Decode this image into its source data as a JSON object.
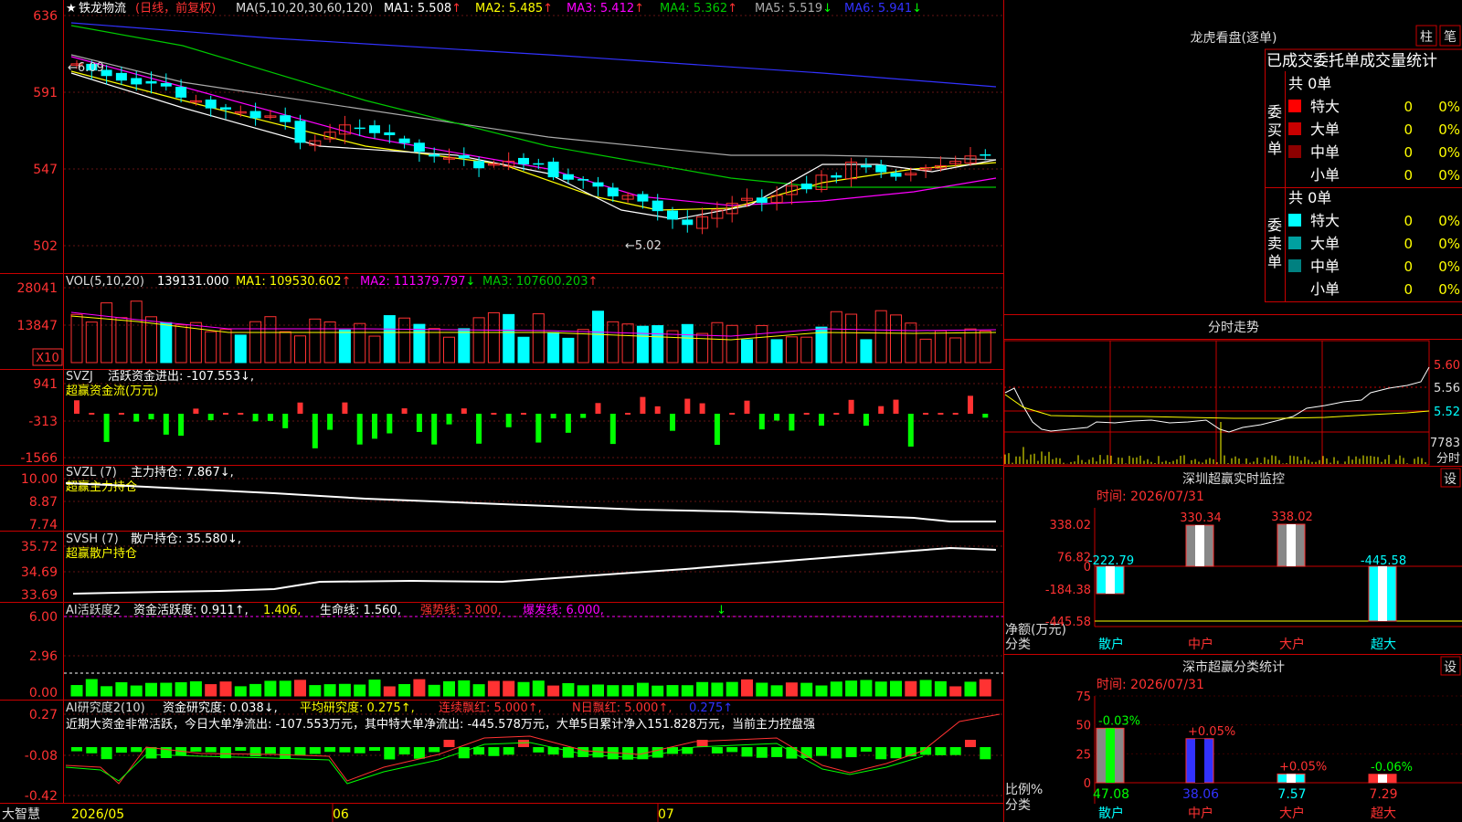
{
  "stock": {
    "name": "铁龙物流",
    "period": "(日线，前复权)"
  },
  "colors": {
    "up": "#ff3232",
    "down": "#00ffff",
    "grid": "#c80000",
    "axis_text": "#ff3232",
    "bg": "#000000",
    "ma1": "#ffffff",
    "ma2": "#ffff00",
    "ma3": "#ff00ff",
    "ma4": "#00c800",
    "ma5": "#aaaaaa",
    "ma6": "#3232ff"
  },
  "main": {
    "header": {
      "prefix": "MA(5,10,20,30,60,120)",
      "items": [
        {
          "label": "MA1:",
          "value": "5.508",
          "arrow": "↑"
        },
        {
          "label": "MA2:",
          "value": "5.485",
          "arrow": "↑"
        },
        {
          "label": "MA3:",
          "value": "5.412",
          "arrow": "↑"
        },
        {
          "label": "MA4:",
          "value": "5.362",
          "arrow": "↑"
        },
        {
          "label": "MA5:",
          "value": "5.519",
          "arrow": "↓"
        },
        {
          "label": "MA6:",
          "value": "5.941",
          "arrow": "↓"
        }
      ]
    },
    "yticks": [
      "636",
      "591",
      "547",
      "502"
    ],
    "high_label": "←6.09",
    "low_label": "←5.02"
  },
  "volume": {
    "header": {
      "prefix": "VOL(5,10,20)",
      "value": "139131.000",
      "items": [
        {
          "label": "MA1:",
          "value": "109530.602",
          "arrow": "↑"
        },
        {
          "label": "MA2:",
          "value": "111379.797",
          "arrow": "↓"
        },
        {
          "label": "MA3:",
          "value": "107600.203",
          "arrow": "↑"
        }
      ]
    },
    "yticks": [
      "28041",
      "13847"
    ],
    "unit": "X10"
  },
  "svzj": {
    "title": "SVZJ",
    "line1": "活跃资金进出: -107.553↓,",
    "line2": "超赢资金流(万元)",
    "yticks": [
      "941",
      "-313",
      "-1566"
    ]
  },
  "svzl": {
    "title": "SVZL (7)",
    "line1": "主力持仓: 7.867↓,",
    "line2": "超赢主力持仓",
    "yticks": [
      "10.00",
      "8.87",
      "7.74"
    ]
  },
  "svsh": {
    "title": "SVSH (7)",
    "line1": "散户持仓: 35.580↓,",
    "line2": "超赢散户持仓",
    "yticks": [
      "35.72",
      "34.69",
      "33.69"
    ]
  },
  "ai1": {
    "title": "AI活跃度2",
    "t1": "资金活跃度: 0.911↑,",
    "t2": "1.406,",
    "t3": "生命线: 1.560,",
    "t4": "强势线: 3.000,",
    "t5": "爆发线: 6.000,",
    "yticks": [
      "6.00",
      "2.96",
      "0.00"
    ]
  },
  "ai2": {
    "title": "AI研究度2(10)",
    "t1": "资金研究度: 0.038↓,",
    "t2": "平均研究度: 0.275↑,",
    "t3": "连续飘红: 5.000↑,",
    "t4": "N日飘红: 5.000↑,",
    "t5": "0.275↑",
    "desc": "近期大资金非常活跃，今日大单净流出: -107.553万元，其中特大单净流出: -445.578万元，大单5日累计净入151.828万元，当前主力控盘强",
    "yticks": [
      "0.27",
      "-0.08",
      "-0.42"
    ]
  },
  "xaxis": {
    "labels": [
      "2026/05",
      "06",
      "07"
    ],
    "brand": "大智慧"
  },
  "dragon": {
    "title": "龙虎看盘(逐单)",
    "btn1": "柱",
    "btn2": "笔",
    "subtitle": "已成交委托单成交量统计",
    "buy": {
      "side": "委买单",
      "total": "共 0单",
      "rows": [
        {
          "label": "特大",
          "v": "0",
          "p": "0%"
        },
        {
          "label": "大单",
          "v": "0",
          "p": "0%"
        },
        {
          "label": "中单",
          "v": "0",
          "p": "0%"
        },
        {
          "label": "小单",
          "v": "0",
          "p": "0%"
        }
      ]
    },
    "sell": {
      "side": "委卖单",
      "total": "共 0单",
      "rows": [
        {
          "label": "特大",
          "v": "0",
          "p": "0%"
        },
        {
          "label": "大单",
          "v": "0",
          "p": "0%"
        },
        {
          "label": "中单",
          "v": "0",
          "p": "0%"
        },
        {
          "label": "小单",
          "v": "0",
          "p": "0%"
        }
      ]
    }
  },
  "intraday": {
    "title": "分时走势",
    "yticks": [
      "5.60",
      "5.56",
      "5.52"
    ],
    "vol_label": "7783",
    "vol_unit": "分时"
  },
  "monitor": {
    "title": "深圳超赢实时监控",
    "btn": "设",
    "time": "时间: 2026/07/31",
    "ylabel": "净额(万元)",
    "ylabel2": "分类",
    "yticks": [
      "338.02",
      "76.82",
      "0",
      "-184.38",
      "-445.58"
    ],
    "cats": [
      "散户",
      "中户",
      "大户",
      "超大"
    ],
    "values": [
      -222.79,
      330.34,
      338.02,
      -445.58
    ],
    "value_labels": [
      "-222.79",
      "330.34",
      "338.02",
      "-445.58"
    ]
  },
  "classify": {
    "title": "深市超赢分类统计",
    "btn": "设",
    "time": "时间: 2026/07/31",
    "ylabel": "比例%",
    "ylabel2": "分类",
    "yticks": [
      "75",
      "50",
      "25",
      "0"
    ],
    "cats": [
      "散户",
      "中户",
      "大户",
      "超大"
    ],
    "values": [
      47.08,
      38.06,
      7.57,
      7.29
    ],
    "value_labels": [
      "47.08",
      "38.06",
      "7.57",
      "7.29"
    ],
    "changes": [
      "-0.03%",
      "+0.05%",
      "+0.05%",
      "-0.06%"
    ]
  },
  "chart_data": [
    {
      "type": "bar",
      "title": "深圳超赢实时监控",
      "ylabel": "净额(万元)",
      "categories": [
        "散户",
        "中户",
        "大户",
        "超大"
      ],
      "values": [
        -222.79,
        330.34,
        338.02,
        -445.58
      ],
      "ylim": [
        -445.58,
        338.02
      ]
    },
    {
      "type": "bar",
      "title": "深市超赢分类统计",
      "ylabel": "比例%",
      "categories": [
        "散户",
        "中户",
        "大户",
        "超大"
      ],
      "values": [
        47.08,
        38.06,
        7.57,
        7.29
      ],
      "ylim": [
        0,
        75
      ]
    },
    {
      "type": "line",
      "title": "铁龙物流 (日线，前复权)",
      "series": [
        {
          "name": "MA1",
          "last": 5.508
        },
        {
          "name": "MA2",
          "last": 5.485
        },
        {
          "name": "MA3",
          "last": 5.412
        },
        {
          "name": "MA4",
          "last": 5.362
        },
        {
          "name": "MA5",
          "last": 5.519
        },
        {
          "name": "MA6",
          "last": 5.941
        }
      ],
      "yticks": [
        6.36,
        5.91,
        5.47,
        5.02
      ],
      "high": 6.09,
      "low": 5.02
    }
  ]
}
